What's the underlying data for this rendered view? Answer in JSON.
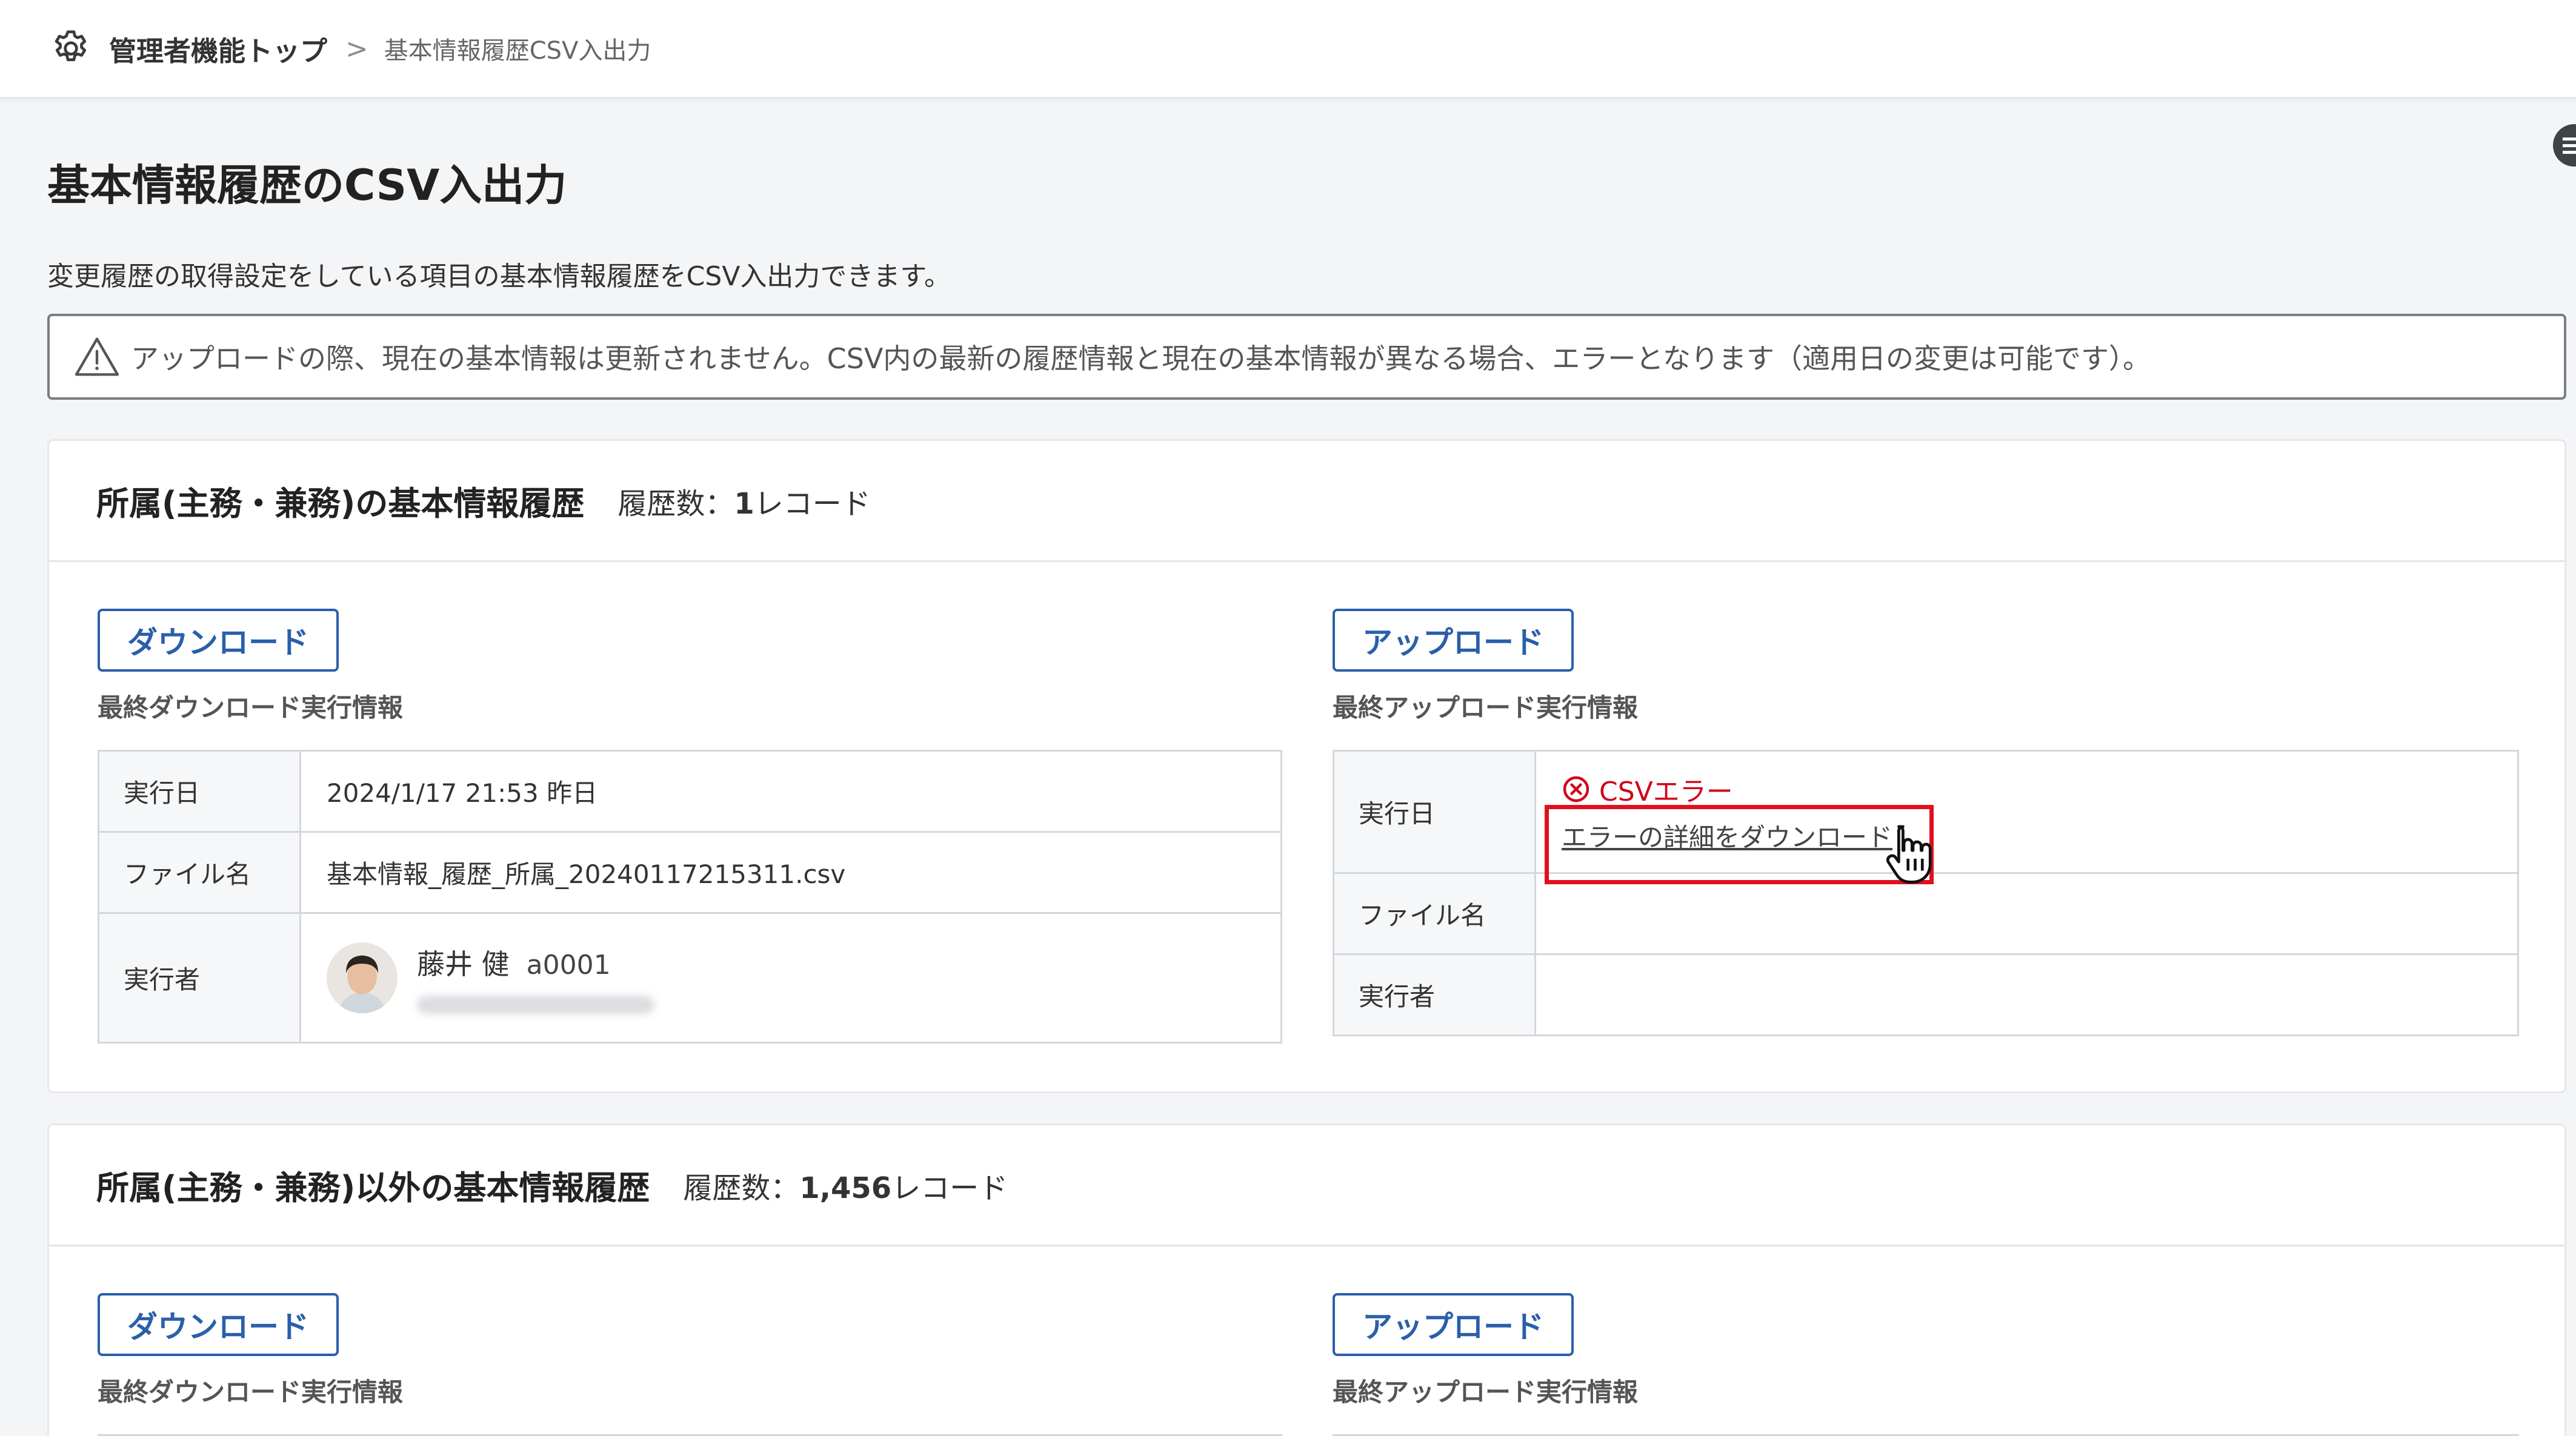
{
  "breadcrumb": {
    "top": "管理者機能トップ",
    "separator": ">",
    "current": "基本情報履歴CSV入出力"
  },
  "page": {
    "title": "基本情報履歴のCSV入出力",
    "description": "変更履歴の取得設定をしている項目の基本情報履歴をCSV入出力できます。",
    "notice": "アップロードの際、現在の基本情報は更新されません。CSV内の最新の履歴情報と現在の基本情報が異なる場合、エラーとなります（適用日の変更は可能です）。"
  },
  "section1": {
    "title": "所属(主務・兼務)の基本情報履歴",
    "count_prefix": "履歴数：",
    "count": "1",
    "count_suffix": "レコード",
    "download_button": "ダウンロード",
    "download_info_label": "最終ダウンロード実行情報",
    "upload_button": "アップロード",
    "upload_info_label": "最終アップロード実行情報",
    "download_table": {
      "date_label": "実行日",
      "date_value": "2024/1/17 21:53 昨日",
      "file_label": "ファイル名",
      "file_value": "基本情報_履歴_所属_20240117215311.csv",
      "executor_label": "実行者",
      "executor_name": "藤井 健",
      "executor_id": "a0001"
    },
    "upload_table": {
      "date_label": "実行日",
      "error_text": "CSVエラー",
      "error_link": "エラーの詳細をダウンロード",
      "file_label": "ファイル名",
      "executor_label": "実行者"
    }
  },
  "section2": {
    "title": "所属(主務・兼務)以外の基本情報履歴",
    "count_prefix": "履歴数：",
    "count": "1,456",
    "count_suffix": "レコード",
    "download_button": "ダウンロード",
    "download_info_label": "最終ダウンロード実行情報",
    "upload_button": "アップロード",
    "upload_info_label": "最終アップロード実行情報"
  },
  "colors": {
    "accent": "#2a5faa",
    "error": "#d0021b",
    "highlight": "#e0101d"
  }
}
